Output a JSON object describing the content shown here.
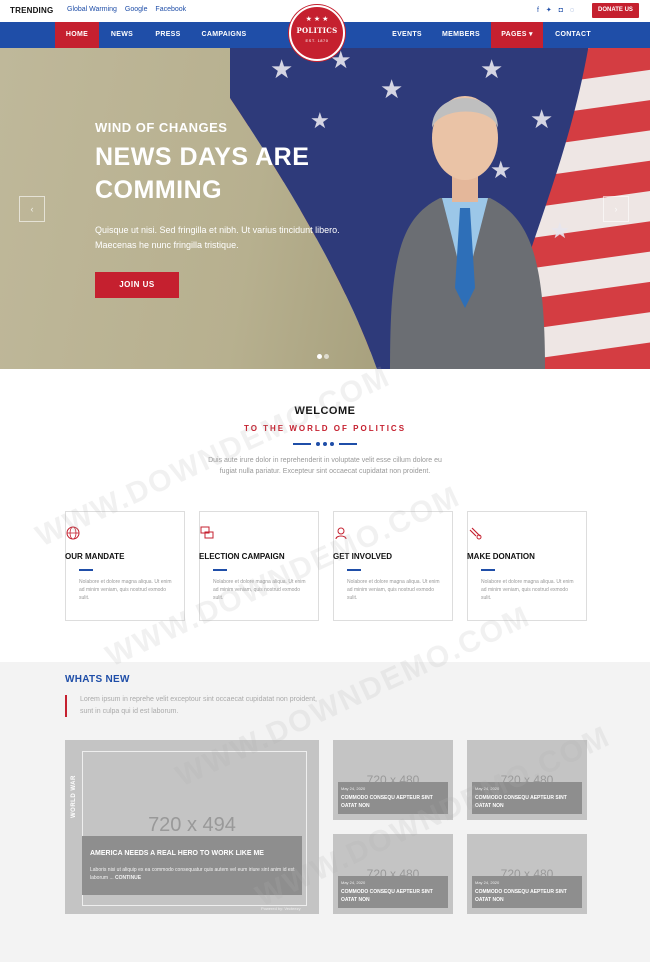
{
  "topbar": {
    "trending_label": "TRENDING",
    "trending_links": [
      "Global Warming",
      "Google",
      "Facebook"
    ],
    "social_icons": [
      "facebook-icon",
      "twitter-icon",
      "instagram-icon",
      "skype-icon"
    ],
    "donate_label": "DONATE US"
  },
  "logo": {
    "name": "POLITICS",
    "est": "EST. 1870"
  },
  "nav": {
    "items": [
      "HOME",
      "NEWS",
      "PRESS",
      "CAMPAIGNS",
      "EVENTS",
      "MEMBERS",
      "PAGES",
      "CONTACT"
    ],
    "active": "HOME",
    "pages_caret": "▾"
  },
  "hero": {
    "kicker": "WIND OF CHANGES",
    "title_line1": "NEWS DAYS ARE",
    "title_line2": "COMMING",
    "text": "Quisque ut nisi. Sed fringilla et nibh. Ut varius tincidunt libero. Maecenas he nunc fringilla tristique.",
    "button": "JOIN US",
    "prev": "‹",
    "next": "›"
  },
  "welcome": {
    "title": "WELCOME",
    "subtitle": "TO THE WORLD OF POLITICS",
    "text": "Duis aute irure dolor in reprehenderit in voluptate velit esse cillum dolore eu fugiat nulla pariatur. Excepteur sint occaecat cupidatat non proident."
  },
  "cards": [
    {
      "title": "OUR MANDATE",
      "icon": "globe-icon",
      "text": "Nolabore et dolore magna aliqua. Ut enim ad minim veniam, quis nostrud exmodo sulit."
    },
    {
      "title": "ELECTION CAMPAIGN",
      "icon": "chat-icon",
      "text": "Nolabore et dolore magna aliqua. Ut enim ad minim veniam, quis nostrud exmodo sulit."
    },
    {
      "title": "GET INVOLVED",
      "icon": "person-icon",
      "text": "Nolabore et dolore magna aliqua. Ut enim ad minim veniam, quis nostrud exmodo sulit."
    },
    {
      "title": "MAKE DONATION",
      "icon": "hand-icon",
      "text": "Nolabore et dolore magna aliqua. Ut enim ad minim veniam, quis nostrud exmodo sulit."
    }
  ],
  "news": {
    "title": "WHATS NEW",
    "text": "Lorem ipsum in reprehe velit exceptour sint occaecat cupidatat non proident, sunt in culpa qui id est laborum.",
    "featured": {
      "category": "WORLD WAR",
      "placeholder": "720 x 494",
      "title": "AMERICA NEEDS A REAL HERO TO WORK LIKE ME",
      "text": "Laboris nisi ut aliquip ex ea commodo consequatur quis autem vel eum iriure sint anim id est laborum ...",
      "more": "CONTINUE",
      "credit": "Powered by: Vecteezy"
    },
    "items": [
      {
        "placeholder": "720 x 480",
        "date": "May 24, 2020",
        "title": "COMMODO CONSEQU AEPTEUR SINT OATAT NON"
      },
      {
        "placeholder": "720 x 480",
        "date": "May 24, 2020",
        "title": "COMMODO CONSEQU AEPTEUR SINT OATAT NON"
      },
      {
        "placeholder": "720 x 480",
        "date": "May 24, 2020",
        "title": "COMMODO CONSEQU AEPTEUR SINT OATAT NON"
      },
      {
        "placeholder": "720 x 480",
        "date": "May 24, 2020",
        "title": "COMMODO CONSEQU AEPTEUR SINT OATAT NON"
      }
    ]
  },
  "watermark": "WWW.DOWNDEMO.COM",
  "colors": {
    "primary_blue": "#1f4ea8",
    "accent_red": "#c5202f",
    "muted_text": "#999999"
  }
}
